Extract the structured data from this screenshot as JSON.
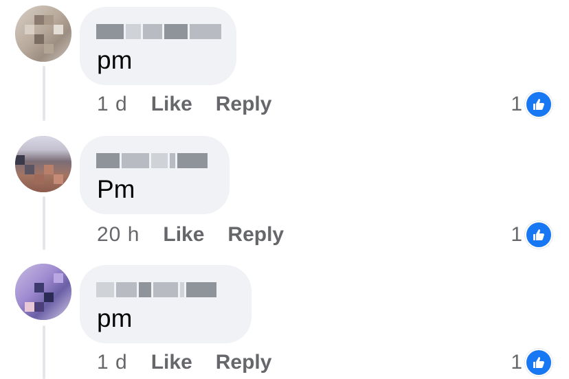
{
  "colors": {
    "bubble": "#f0f2f5",
    "meta_text": "#65676b",
    "like_blue": "#1877f2",
    "thread_line": "#e4e6eb"
  },
  "comments": [
    {
      "text": "pm",
      "time": "1 d",
      "like_label": "Like",
      "reply_label": "Reply",
      "reaction_count": "1",
      "reaction_icon": "thumbs-up-icon"
    },
    {
      "text": "Pm",
      "time": "20 h",
      "like_label": "Like",
      "reply_label": "Reply",
      "reaction_count": "1",
      "reaction_icon": "thumbs-up-icon"
    },
    {
      "text": "pm",
      "time": "1 d",
      "like_label": "Like",
      "reply_label": "Reply",
      "reaction_count": "1",
      "reaction_icon": "thumbs-up-icon"
    }
  ]
}
